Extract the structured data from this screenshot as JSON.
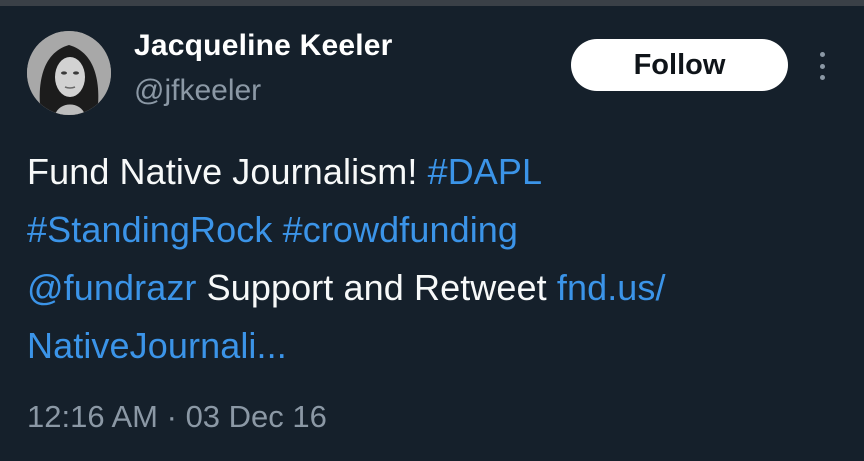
{
  "user": {
    "display_name": "Jacqueline Keeler",
    "handle": "@jfkeeler",
    "avatar_icon": "profile-photo"
  },
  "actions": {
    "follow_label": "Follow",
    "more_icon": "more-vertical-icon"
  },
  "tweet": {
    "text_1": "Fund Native Journalism!",
    "hashtag_dapl": "#DAPL",
    "hashtag_standingrock": "#StandingRock",
    "hashtag_crowdfunding": "#crowdfunding",
    "mention": "@fundrazr",
    "text_2": "Support and Retweet",
    "link_line_1": "fnd.us/",
    "link_line_2": "NativeJournali..."
  },
  "meta": {
    "time": "12:16 AM",
    "separator": "·",
    "date": "03 Dec 16"
  },
  "colors": {
    "background": "#15202b",
    "link": "#3b94e8",
    "secondary_text": "#8b98a5",
    "primary_text": "#f7f9f9"
  }
}
